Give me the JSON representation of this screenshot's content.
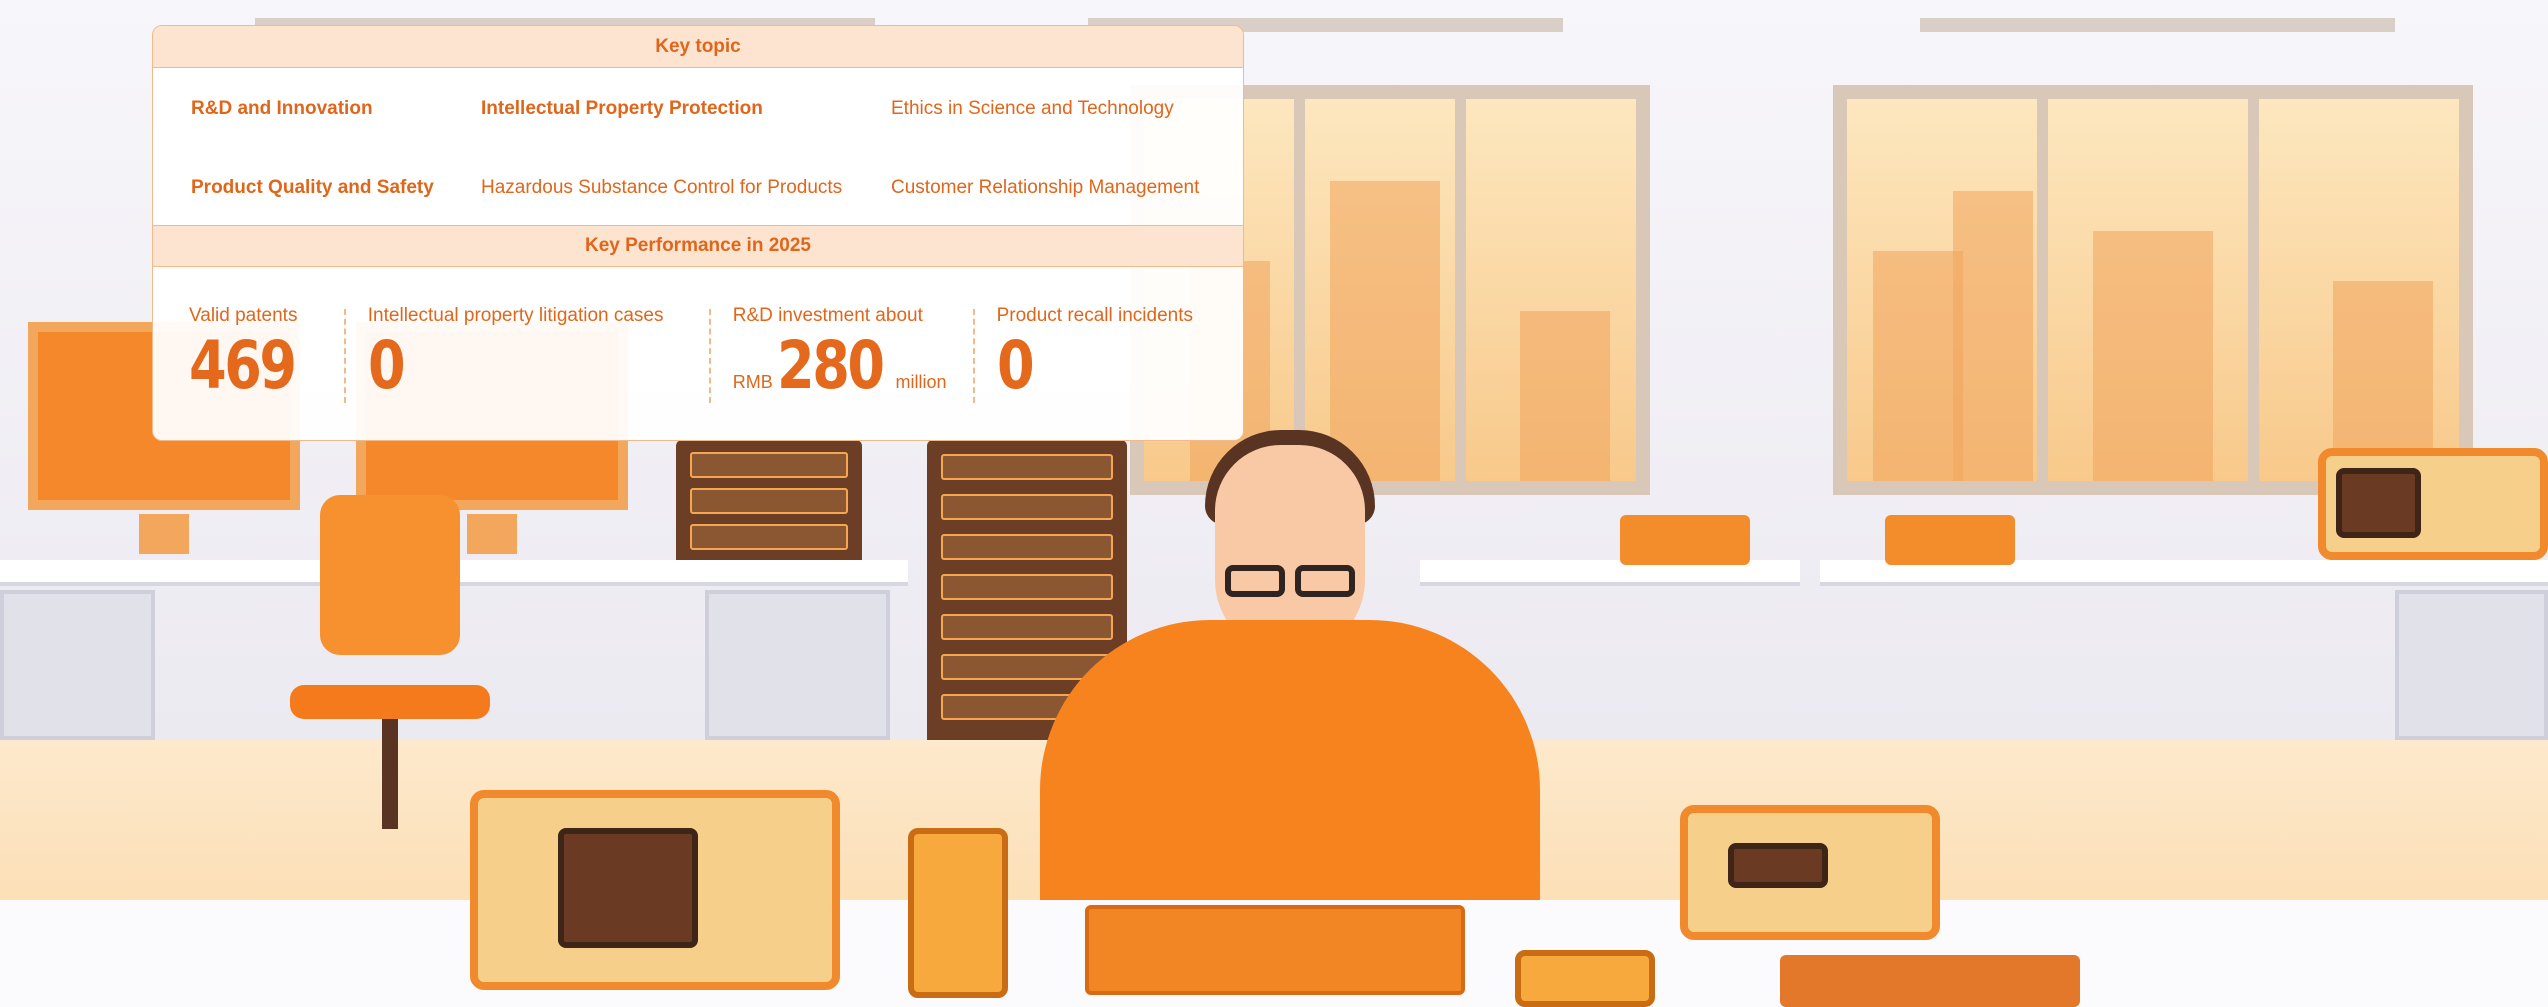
{
  "background_image_description": "",
  "key_topic": {
    "title": "Key topic",
    "items": [
      {
        "label": "R&D and Innovation",
        "emphasis": true
      },
      {
        "label": "Intellectual Property Protection",
        "emphasis": true
      },
      {
        "label": "Ethics in Science and Technology",
        "emphasis": false
      },
      {
        "label": "Product Quality and Safety",
        "emphasis": true
      },
      {
        "label": "Hazardous Substance Control for Products",
        "emphasis": false
      },
      {
        "label": "Customer Relationship Management",
        "emphasis": false
      }
    ]
  },
  "key_performance": {
    "title": "Key Performance in 2025",
    "metrics": [
      {
        "label": "Valid patents",
        "prefix": "",
        "value": "469",
        "suffix": ""
      },
      {
        "label": "Intellectual property litigation cases",
        "prefix": "",
        "value": "0",
        "suffix": ""
      },
      {
        "label": "R&D investment about",
        "prefix": "RMB",
        "value": "280",
        "suffix": "million"
      },
      {
        "label": "Product recall incidents",
        "prefix": "",
        "value": "0",
        "suffix": ""
      }
    ]
  },
  "colors": {
    "accent": "#e0661b",
    "header_bg": "#fde4d0",
    "border": "#f2b98a"
  }
}
